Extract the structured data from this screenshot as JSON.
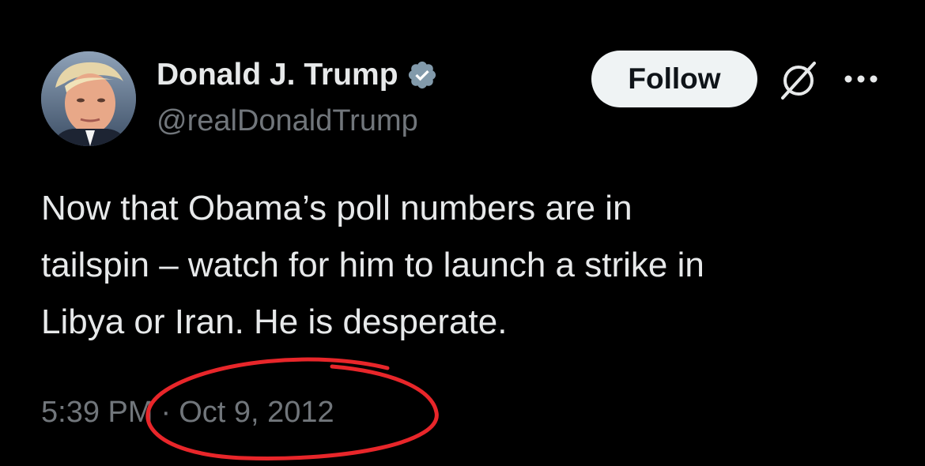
{
  "author": {
    "display_name": "Donald J. Trump",
    "handle": "@realDonaldTrump",
    "verified": true
  },
  "actions": {
    "follow_label": "Follow",
    "grok_icon": "grok-icon",
    "more_icon": "more-horizontal-icon"
  },
  "tweet": {
    "text": "Now that Obama’s poll numbers are in\ntailspin – watch for him to launch a strike in\nLibya or Iran.  He is desperate.",
    "time": "5:39 PM",
    "separator": "·",
    "date": "Oct 9, 2012"
  },
  "colors": {
    "background": "#000000",
    "primary_text": "#e7e9ea",
    "secondary_text": "#71767b",
    "verified_badge": "#829aab",
    "follow_button_bg": "#eff3f4",
    "annotation_circle": "#e8262a"
  }
}
